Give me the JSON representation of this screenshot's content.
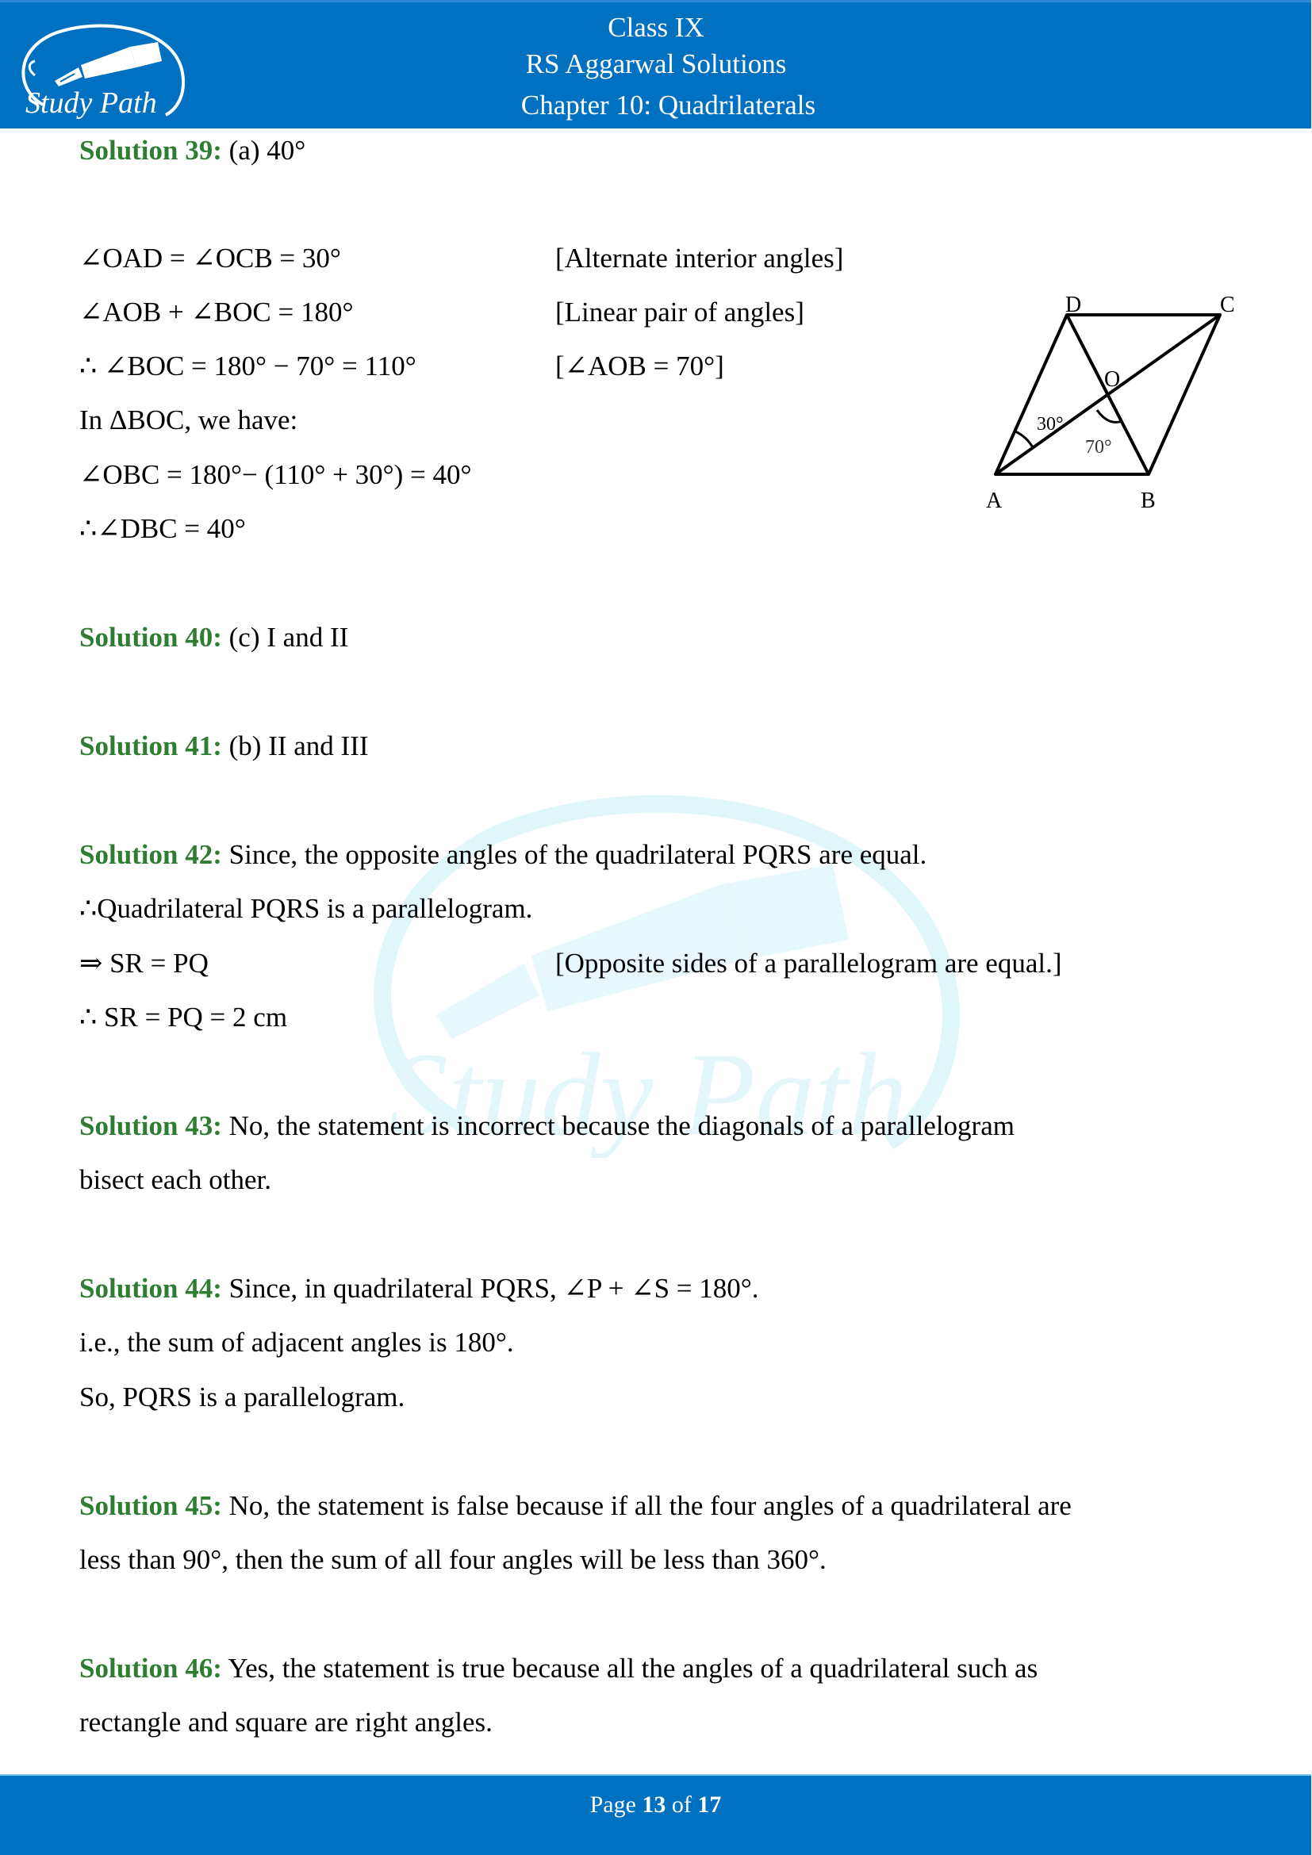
{
  "header": {
    "class": "Class IX",
    "book": "RS Aggarwal Solutions",
    "chapter": "Chapter 10: Quadrilaterals",
    "logo_text": "Study Path",
    "logo_icon": "fountain-pen-icon",
    "colors": {
      "bar": "#0070c0",
      "text": "#ffffff"
    }
  },
  "watermark": {
    "text": "Study Path",
    "icon": "fountain-pen-icon",
    "color": "#e0f7fa"
  },
  "solutions": {
    "s39": {
      "label": "Solution 39:",
      "answer": " (a) 40°",
      "steps": [
        {
          "expr": "∠OAD =   ∠OCB = 30°",
          "reason": "[Alternate interior angles]"
        },
        {
          "expr": "∠AOB + ∠BOC = 180°",
          "reason": "[Linear pair of angles]"
        },
        {
          "expr": "∴ ∠BOC = 180° − 70° = 110°",
          "reason": "[∠AOB = 70°]"
        },
        {
          "expr": "In ΔBOC, we have:"
        },
        {
          "expr": "∠OBC = 180°− (110° + 30°) = 40°"
        },
        {
          "expr": "∴∠DBC = 40°"
        }
      ],
      "diagram": {
        "vertices": {
          "A": "A",
          "B": "B",
          "C": "C",
          "D": "D",
          "O": "O"
        },
        "angle_labels": {
          "oac": "30°",
          "aob": "70°"
        }
      }
    },
    "s40": {
      "label": "Solution 40:",
      "text": " (c) I and II"
    },
    "s41": {
      "label": "Solution 41:",
      "text": " (b) II and III"
    },
    "s42": {
      "label": "Solution 42:",
      "text": " Since, the opposite angles of the quadrilateral PQRS are equal.",
      "lines": [
        {
          "expr": "∴Quadrilateral PQRS is a parallelogram."
        },
        {
          "expr": "⇒ SR = PQ",
          "reason": "[Opposite sides of a parallelogram are equal.]"
        },
        {
          "expr": "∴ SR = PQ = 2 cm"
        }
      ]
    },
    "s43": {
      "label": "Solution 43:",
      "text": " No, the statement is incorrect because the diagonals of a parallelogram",
      "cont": "bisect each other."
    },
    "s44": {
      "label": "Solution 44:",
      "text": " Since, in quadrilateral PQRS, ∠P + ∠S = 180°.",
      "lines": [
        "i.e., the sum of adjacent angles is 180°.",
        "So, PQRS is a parallelogram."
      ]
    },
    "s45": {
      "label": "Solution 45:",
      "text": "  No, the statement is false because if all the four angles of a quadrilateral are",
      "cont": "less than 90°, then the sum of all four angles will be less than 360°."
    },
    "s46": {
      "label": "Solution 46:",
      "text": " Yes, the statement is true because all the angles of a quadrilateral such as",
      "cont": "rectangle and square are right angles."
    },
    "label_color": "#2e7d32"
  },
  "footer": {
    "page_prefix": "Page ",
    "page_current": "13",
    "page_sep": " of ",
    "page_total": "17"
  }
}
